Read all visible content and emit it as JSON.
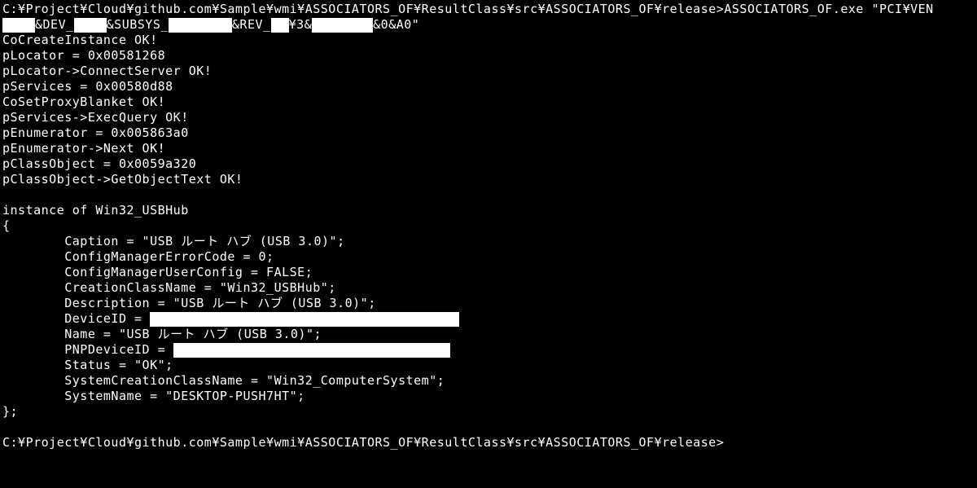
{
  "cmd": {
    "prompt_prefix": "C:¥Project¥Cloud¥github.com¥Sample¥wmi¥ASSOCIATORS_OF¥ResultClass¥src¥ASSOCIATORS_OF¥release>",
    "exe_call": "ASSOCIATORS_OF.exe \"PCI¥VEN",
    "line2_a": "&DEV_",
    "line2_b": "&SUBSYS_",
    "line2_c": "&REV_",
    "line2_d": "¥3&",
    "line2_e": "&0&A0\""
  },
  "out": {
    "l1": "CoCreateInstance OK!",
    "l2": "pLocator = 0x00581268",
    "l3": "pLocator->ConnectServer OK!",
    "l4": "pServices = 0x00580d88",
    "l5": "CoSetProxyBlanket OK!",
    "l6": "pServices->ExecQuery OK!",
    "l7": "pEnumerator = 0x005863a0",
    "l8": "pEnumerator->Next OK!",
    "l9": "pClassObject = 0x0059a320",
    "l10": "pClassObject->GetObjectText OK!"
  },
  "inst": {
    "header": "instance of Win32_USBHub",
    "open": "{",
    "caption": "        Caption = \"USB ルート ハブ (USB 3.0)\";",
    "cfgerr": "        ConfigManagerErrorCode = 0;",
    "cfgusr": "        ConfigManagerUserConfig = FALSE;",
    "ccname": "        CreationClassName = \"Win32_USBHub\";",
    "desc": "        Description = \"USB ルート ハブ (USB 3.0)\";",
    "devid_label": "        DeviceID = ",
    "name": "        Name = \"USB ルート ハブ (USB 3.0)\";",
    "pnp_label": "        PNPDeviceID = ",
    "status": "        Status = \"OK\";",
    "sccn": "        SystemCreationClassName = \"Win32_ComputerSystem\";",
    "sysname": "        SystemName = \"DESKTOP-PUSH7HT\";",
    "close": "};"
  },
  "prompt2": "C:¥Project¥Cloud¥github.com¥Sample¥wmi¥ASSOCIATORS_OF¥ResultClass¥src¥ASSOCIATORS_OF¥release>"
}
